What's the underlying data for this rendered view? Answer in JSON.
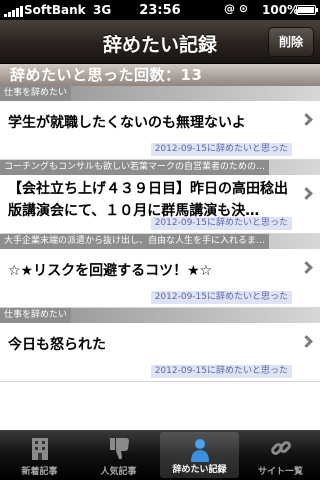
{
  "status_bar": {
    "carrier": "SoftBank",
    "network": "3G",
    "time": "23:56",
    "icons": "@ ⊙",
    "battery": "100%"
  },
  "nav": {
    "title": "辞めたい記録",
    "delete_button": "削除"
  },
  "counter": {
    "text": "辞めたいと思った回数：13"
  },
  "entries": [
    {
      "category": "仕事を辞めたい",
      "text": "学生が就職したくないのも無理ないよ",
      "date": "2012-09-15に辞めたいと思った"
    },
    {
      "category": "コーチングもコンサルも欲しい若葉マークの自営業者のための…",
      "text": "【会社立ち上げ４３９日目】昨日の高田稔出版講演会にて、１０月に群馬講演も決…",
      "date": "2012-09-15に辞めたいと思った"
    },
    {
      "category": "大手企業末端の派遣から抜け出し、自由な人生を手に入れるま…",
      "text": "☆★リスクを回避するコツ！★☆",
      "date": "2012-09-15に辞めたいと思った"
    },
    {
      "category": "仕事を辞めたい",
      "text": "今日も怒られた",
      "date": "2012-09-15に辞めたいと思った"
    }
  ],
  "tabs": [
    {
      "label": "新着記事",
      "icon": "building-icon"
    },
    {
      "label": "人気記事",
      "icon": "thumbs-down-icon"
    },
    {
      "label": "辞めたい記録",
      "icon": "person-icon"
    },
    {
      "label": "サイト一覧",
      "icon": "link-icon"
    }
  ]
}
